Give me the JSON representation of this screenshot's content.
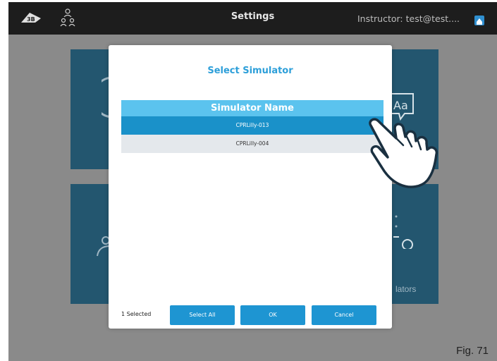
{
  "header": {
    "title": "Settings",
    "instructor": "Instructor: test@test...."
  },
  "background_tiles": {
    "bottom_right_label": "lators"
  },
  "modal": {
    "title": "Select Simulator",
    "column_header": "Simulator Name",
    "rows": [
      {
        "name": "CPRLilly-013",
        "selected": true
      },
      {
        "name": "CPRLilly-004",
        "selected": false
      }
    ],
    "selected_count": "1 Selected",
    "buttons": {
      "select_all": "Select All",
      "ok": "OK",
      "cancel": "Cancel"
    }
  },
  "figure_label": "Fig. 71",
  "colors": {
    "accent": "#1e95d2",
    "header_bar": "#5bc3ee",
    "selected_row": "#1a91c9",
    "tile": "#23566f"
  }
}
